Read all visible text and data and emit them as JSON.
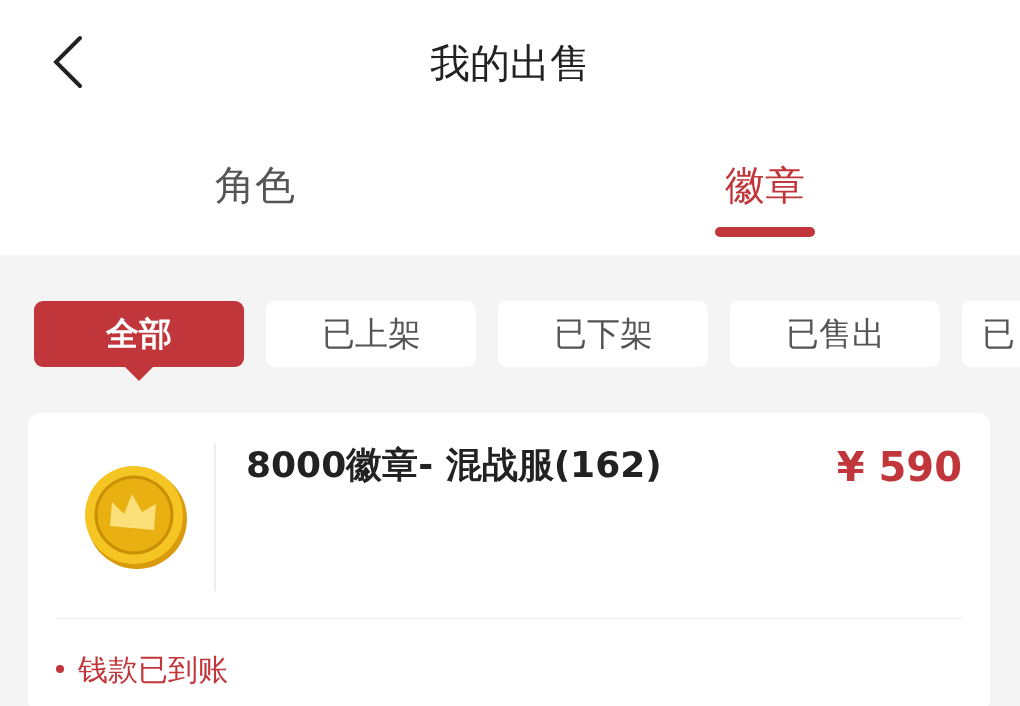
{
  "header": {
    "title": "我的出售"
  },
  "tabs": [
    {
      "label": "角色",
      "selected": false
    },
    {
      "label": "徽章",
      "selected": true
    }
  ],
  "filters": [
    {
      "label": "全部",
      "selected": true
    },
    {
      "label": "已上架",
      "selected": false
    },
    {
      "label": "已下架",
      "selected": false
    },
    {
      "label": "已售出",
      "selected": false
    },
    {
      "label": "已",
      "selected": false
    }
  ],
  "orders": [
    {
      "title": "8000徽章- 混战服(162)",
      "price": "¥ 590",
      "status": "钱款已到账"
    }
  ]
}
